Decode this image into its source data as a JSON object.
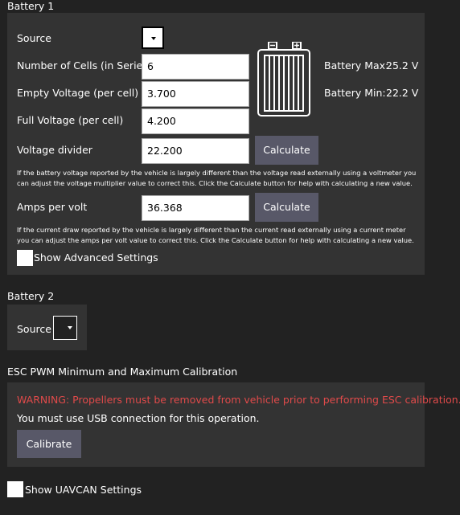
{
  "battery1": {
    "title": "Battery 1",
    "source_label": "Source",
    "cells_label": "Number of Cells (in Series)",
    "cells_value": "6",
    "empty_label": "Empty Voltage (per cell)",
    "empty_value": "3.700",
    "full_label": "Full Voltage (per cell)",
    "full_value": "4.200",
    "divider_label": "Voltage divider",
    "divider_value": "22.200",
    "divider_calc": "Calculate",
    "divider_help_1": "If the battery voltage reported by the vehicle is largely different than the voltage read externally using a voltmeter you",
    "divider_help_2": "can adjust the voltage multiplier value to correct this. Click the Calculate button for help with calculating a new value.",
    "amps_label": "Amps per volt",
    "amps_value": "36.368",
    "amps_calc": "Calculate",
    "amps_help_1": "If the current draw reported by the vehicle is largely different than the current read externally using a current meter",
    "amps_help_2": "you can adjust the amps per volt value to correct this. Click the Calculate button for help with calculating a new value.",
    "advanced_label": "Show Advanced Settings",
    "max_label": "Battery Max:",
    "max_value": "25.2 V",
    "min_label": "Battery Min:",
    "min_value": "22.2 V"
  },
  "battery2": {
    "title": "Battery 2",
    "source_label": "Source"
  },
  "esc": {
    "title": "ESC PWM Minimum and Maximum Calibration",
    "warning": "WARNING: Propellers must be removed from vehicle prior to performing ESC calibration.",
    "usb_note": "You must use USB connection for this operation.",
    "calibrate": "Calibrate"
  },
  "uavcan": {
    "label": "Show UAVCAN Settings"
  },
  "colors": {
    "background": "#222222",
    "panel": "#333333",
    "button": "#585868",
    "warning": "#e04a4a"
  }
}
